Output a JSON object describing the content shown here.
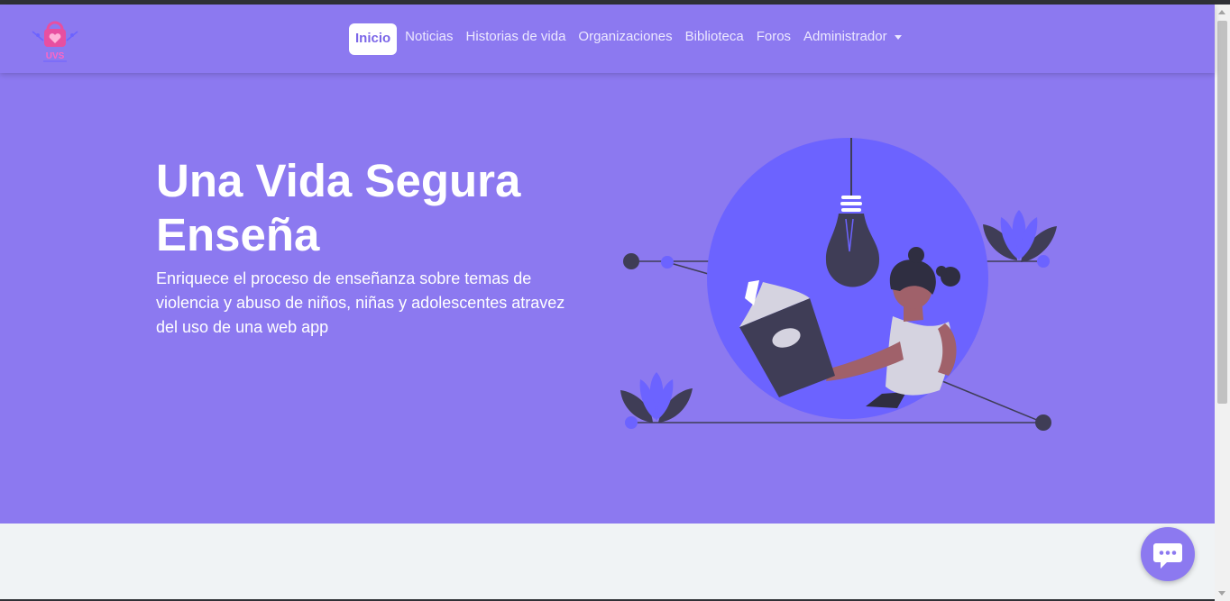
{
  "nav": {
    "logo_text": "UVS",
    "items": [
      {
        "label": "Inicio",
        "active": true
      },
      {
        "label": "Noticias"
      },
      {
        "label": "Historias de vida"
      },
      {
        "label": "Organizaciones"
      },
      {
        "label": "Biblioteca"
      },
      {
        "label": "Foros"
      },
      {
        "label": "Administrador",
        "dropdown": true
      }
    ]
  },
  "hero": {
    "title": "Una Vida Segura Enseña",
    "subtitle": "Enriquece el proceso de enseñanza sobre temas de violencia y abuso de niños, niñas y adolescentes atravez del uso de una web app",
    "illustration_icon": "woman-reading-book-illustration"
  },
  "chat": {
    "icon": "chat-bubble-icon"
  },
  "colors": {
    "primary": "#8c79f0",
    "accent": "#6c63ff",
    "dark": "#3f3d56",
    "background": "#f0f3f5",
    "white": "#ffffff"
  }
}
